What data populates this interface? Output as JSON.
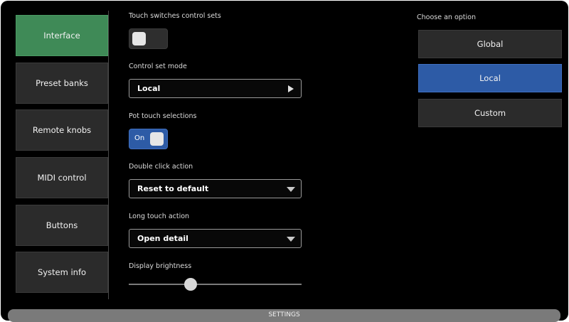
{
  "sidebar": {
    "items": [
      {
        "label": "Interface",
        "active": true
      },
      {
        "label": "Preset banks",
        "active": false
      },
      {
        "label": "Remote knobs",
        "active": false
      },
      {
        "label": "MIDI control",
        "active": false
      },
      {
        "label": "Buttons",
        "active": false
      },
      {
        "label": "System info",
        "active": false
      }
    ]
  },
  "settings": {
    "touch_switches": {
      "label": "Touch switches control sets",
      "on": false
    },
    "control_set_mode": {
      "label": "Control set mode",
      "value": "Local"
    },
    "pot_touch": {
      "label": "Pot touch selections",
      "on": true,
      "on_text": "On"
    },
    "double_click": {
      "label": "Double click action",
      "value": "Reset to default"
    },
    "long_touch": {
      "label": "Long touch action",
      "value": "Open detail"
    },
    "brightness": {
      "label": "Display brightness",
      "level": 0.36
    }
  },
  "options": {
    "title": "Choose an option",
    "items": [
      {
        "label": "Global",
        "selected": false
      },
      {
        "label": "Local",
        "selected": true
      },
      {
        "label": "Custom",
        "selected": false
      }
    ]
  },
  "footer": {
    "label": "SETTINGS"
  },
  "colors": {
    "active_nav": "#3f8a57",
    "selected": "#2d5ba6",
    "background": "#000000"
  }
}
